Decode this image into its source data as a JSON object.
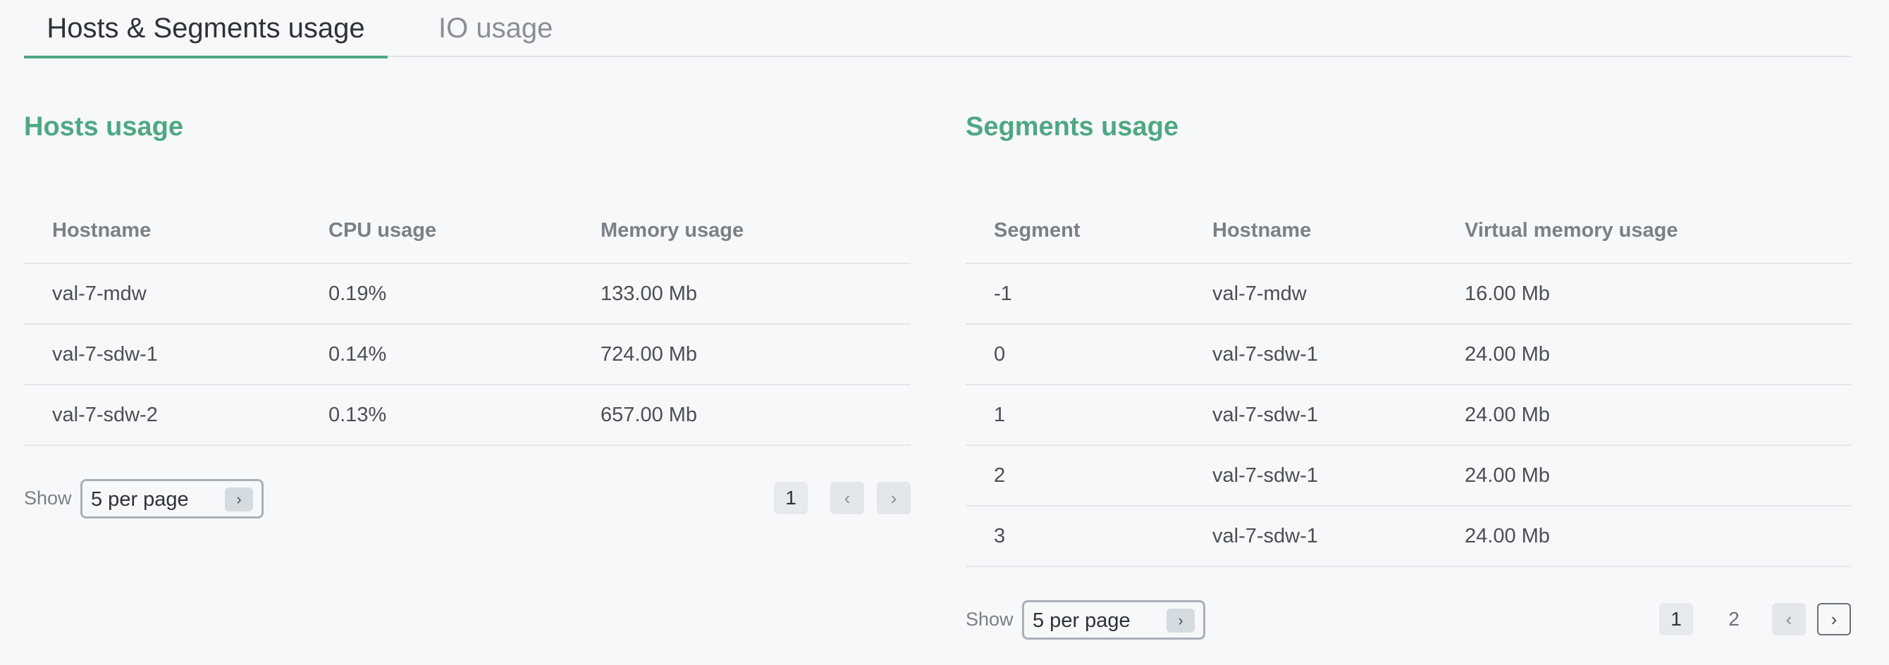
{
  "tabs": [
    {
      "label": "Hosts & Segments usage",
      "active": true
    },
    {
      "label": "IO usage",
      "active": false
    }
  ],
  "hosts": {
    "title": "Hosts usage",
    "columns": [
      "Hostname",
      "CPU usage",
      "Memory usage"
    ],
    "rows": [
      [
        "val-7-mdw",
        "0.19%",
        "133.00 Mb"
      ],
      [
        "val-7-sdw-1",
        "0.14%",
        "724.00 Mb"
      ],
      [
        "val-7-sdw-2",
        "0.13%",
        "657.00 Mb"
      ]
    ],
    "show_label": "Show",
    "per_page": "5 per page",
    "pages": [
      "1"
    ],
    "current_page": "1"
  },
  "segments": {
    "title": "Segments usage",
    "columns": [
      "Segment",
      "Hostname",
      "Virtual memory usage"
    ],
    "rows": [
      [
        "-1",
        "val-7-mdw",
        "16.00 Mb"
      ],
      [
        "0",
        "val-7-sdw-1",
        "24.00 Mb"
      ],
      [
        "1",
        "val-7-sdw-1",
        "24.00 Mb"
      ],
      [
        "2",
        "val-7-sdw-1",
        "24.00 Mb"
      ],
      [
        "3",
        "val-7-sdw-1",
        "24.00 Mb"
      ]
    ],
    "show_label": "Show",
    "per_page": "5 per page",
    "pages": [
      "1",
      "2"
    ],
    "current_page": "1"
  },
  "icons": {
    "chevron": "›",
    "prev": "‹",
    "next": "›"
  }
}
